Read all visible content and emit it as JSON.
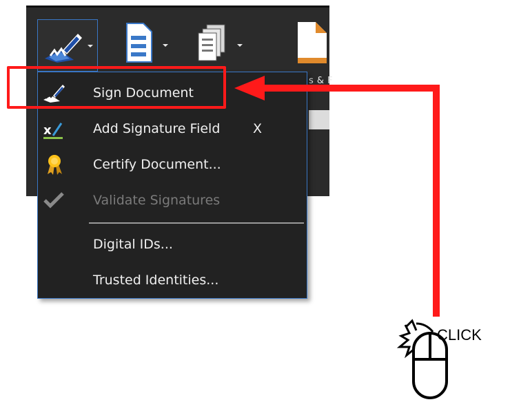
{
  "toolbar": {
    "partial_label": "s & F"
  },
  "menu": {
    "items": [
      {
        "label": "Sign Document",
        "icon": "sign-pen-icon",
        "enabled": true
      },
      {
        "label": "Add Signature Field",
        "shortcut": "X",
        "icon": "signature-field-icon",
        "enabled": true
      },
      {
        "label": "Certify Document...",
        "icon": "certificate-ribbon-icon",
        "enabled": true
      },
      {
        "label": "Validate Signatures",
        "icon": "checkmark-icon",
        "enabled": false
      },
      {
        "label": "Digital IDs...",
        "enabled": true
      },
      {
        "label": "Trusted Identities...",
        "enabled": true
      }
    ]
  },
  "annotation": {
    "click_text": "CLICK",
    "arrow_color": "#ff1a1a",
    "highlight_color": "#ff1a1a"
  },
  "colors": {
    "menu_bg": "#222222",
    "menu_border": "#3a78c8",
    "text": "#f0f0f0",
    "disabled_text": "#7a7a7a"
  }
}
